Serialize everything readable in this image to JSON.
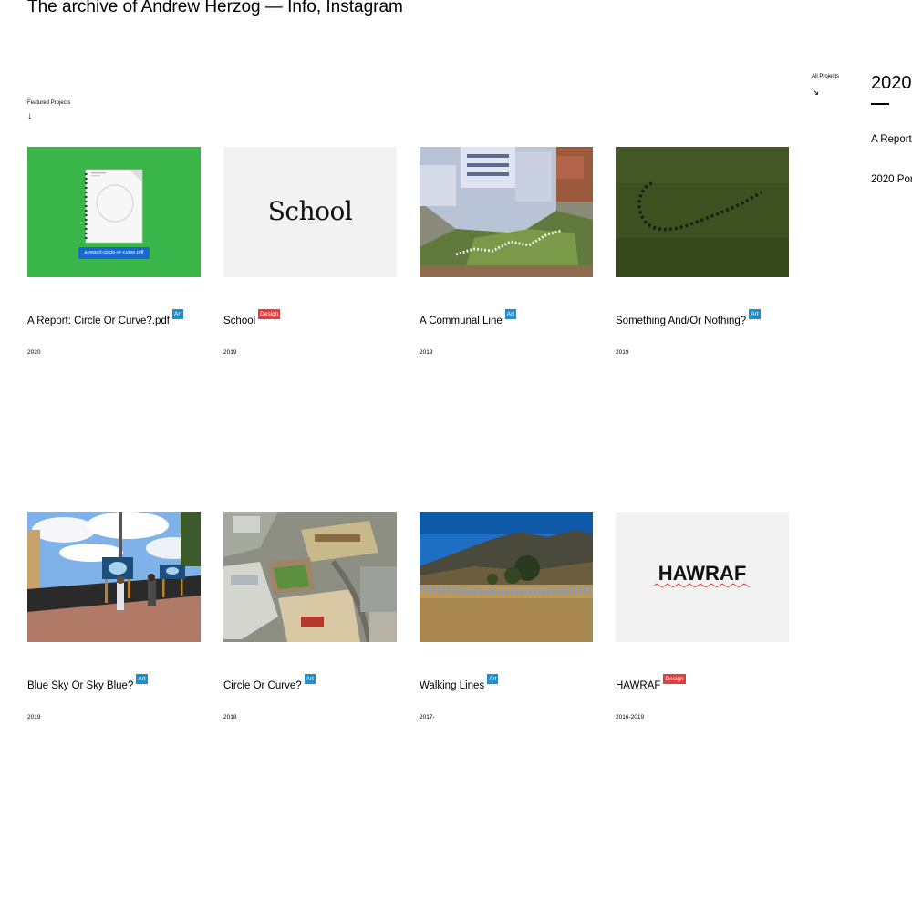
{
  "header": {
    "title": "The archive of Andrew Herzog — Info, Instagram"
  },
  "featured": {
    "label": "Featured Projects",
    "arrow": "↓"
  },
  "all_projects": {
    "label": "All Projects",
    "arrow": "↘"
  },
  "projects": [
    {
      "title": "A Report: Circle Or Curve?.pdf",
      "tag": "Art",
      "year": "2020",
      "thumb_caption": "a-report-circle-or-curve.pdf"
    },
    {
      "title": "School",
      "tag": "Design",
      "year": "2019",
      "thumb_caption": "School"
    },
    {
      "title": "A Communal Line",
      "tag": "Art",
      "year": "2019"
    },
    {
      "title": "Something And/Or Nothing?",
      "tag": "Art",
      "year": "2019"
    },
    {
      "title": "Blue Sky Or Sky Blue?",
      "tag": "Art",
      "year": "2019"
    },
    {
      "title": "Circle Or Curve?",
      "tag": "Art",
      "year": "2018"
    },
    {
      "title": "Walking Lines",
      "tag": "Art",
      "year": "2017-"
    },
    {
      "title": "HAWRAF",
      "tag": "Design",
      "year": "2016-2019",
      "thumb_caption": "HAWRAF"
    }
  ],
  "sidebar": {
    "year": "2020",
    "items": [
      "A Report",
      "2020 Por"
    ]
  },
  "colors": {
    "art_tag": "#1a8fd8",
    "design_tag": "#e53d3d",
    "thumb_green": "#3ab54a",
    "thumb_gray": "#f2f2f2"
  }
}
